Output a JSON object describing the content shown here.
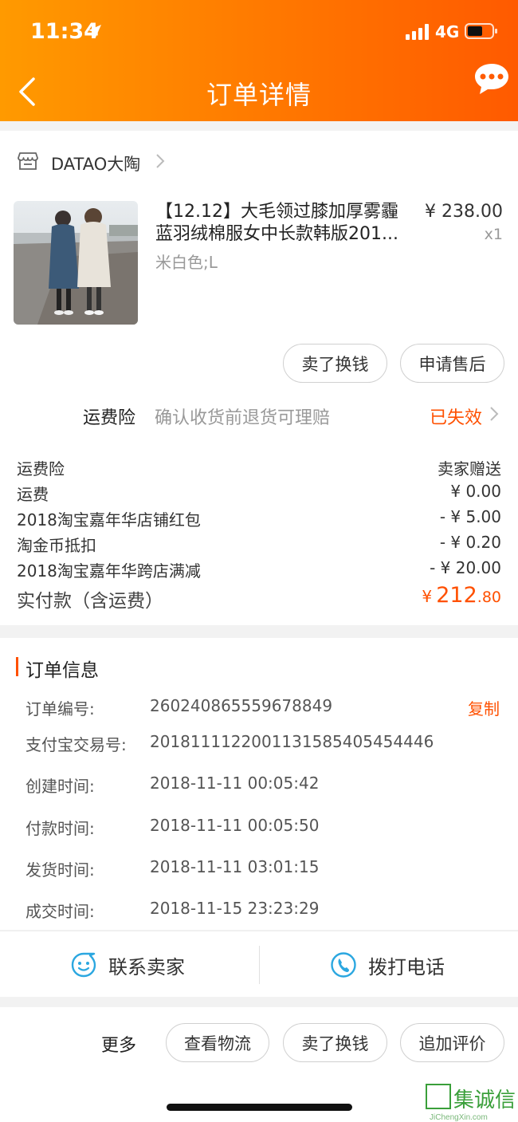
{
  "status_bar": {
    "time": "11:34",
    "network": "4G"
  },
  "nav": {
    "title": "订单详情"
  },
  "shop": {
    "name": "DATAO大陶"
  },
  "item": {
    "title_line1": "【12.12】大毛领过膝加厚雾霾",
    "title_line2": "蓝羽绒棉服女中长款韩版201...",
    "sku": "米白色;L",
    "price": "¥ 238.00",
    "qty": "x1"
  },
  "item_actions": [
    "卖了换钱",
    "申请售后"
  ],
  "insurance": {
    "label": "运费险",
    "desc": "确认收货前退货可理赔",
    "status": "已失效"
  },
  "fees": [
    {
      "label": "运费险",
      "value": "卖家赠送"
    },
    {
      "label": "运费",
      "value": "¥ 0.00"
    },
    {
      "label": "2018淘宝嘉年华店铺红包",
      "value": "- ¥ 5.00"
    },
    {
      "label": "淘金币抵扣",
      "value": "- ¥ 0.20"
    },
    {
      "label": "2018淘宝嘉年华跨店满减",
      "value": "- ¥ 20.00"
    }
  ],
  "total": {
    "label": "实付款（含运费）",
    "currency": "¥",
    "integer": "212",
    "decimal": ".80"
  },
  "order_info": {
    "title": "订单信息",
    "copy_label": "复制",
    "rows": [
      {
        "label": "订单编号:",
        "value": "260240865559678849"
      },
      {
        "label": "支付宝交易号:",
        "value": "2018111122001131585405454446"
      },
      {
        "label": "创建时间:",
        "value": "2018-11-11 00:05:42"
      },
      {
        "label": "付款时间:",
        "value": "2018-11-11 00:05:50"
      },
      {
        "label": "发货时间:",
        "value": "2018-11-11 03:01:15"
      },
      {
        "label": "成交时间:",
        "value": "2018-11-15 23:23:29"
      }
    ]
  },
  "contact": {
    "seller": "联系卖家",
    "phone": "拨打电话"
  },
  "bottom": {
    "more": "更多",
    "buttons": [
      "查看物流",
      "卖了换钱",
      "追加评价"
    ]
  },
  "watermark": {
    "text": "集诚信",
    "sub": "JiChengXin.com"
  },
  "colors": {
    "accent": "#ff5000",
    "header_start": "#ff9a00",
    "header_end": "#ff5a00",
    "icon_blue": "#2ba7e0"
  }
}
